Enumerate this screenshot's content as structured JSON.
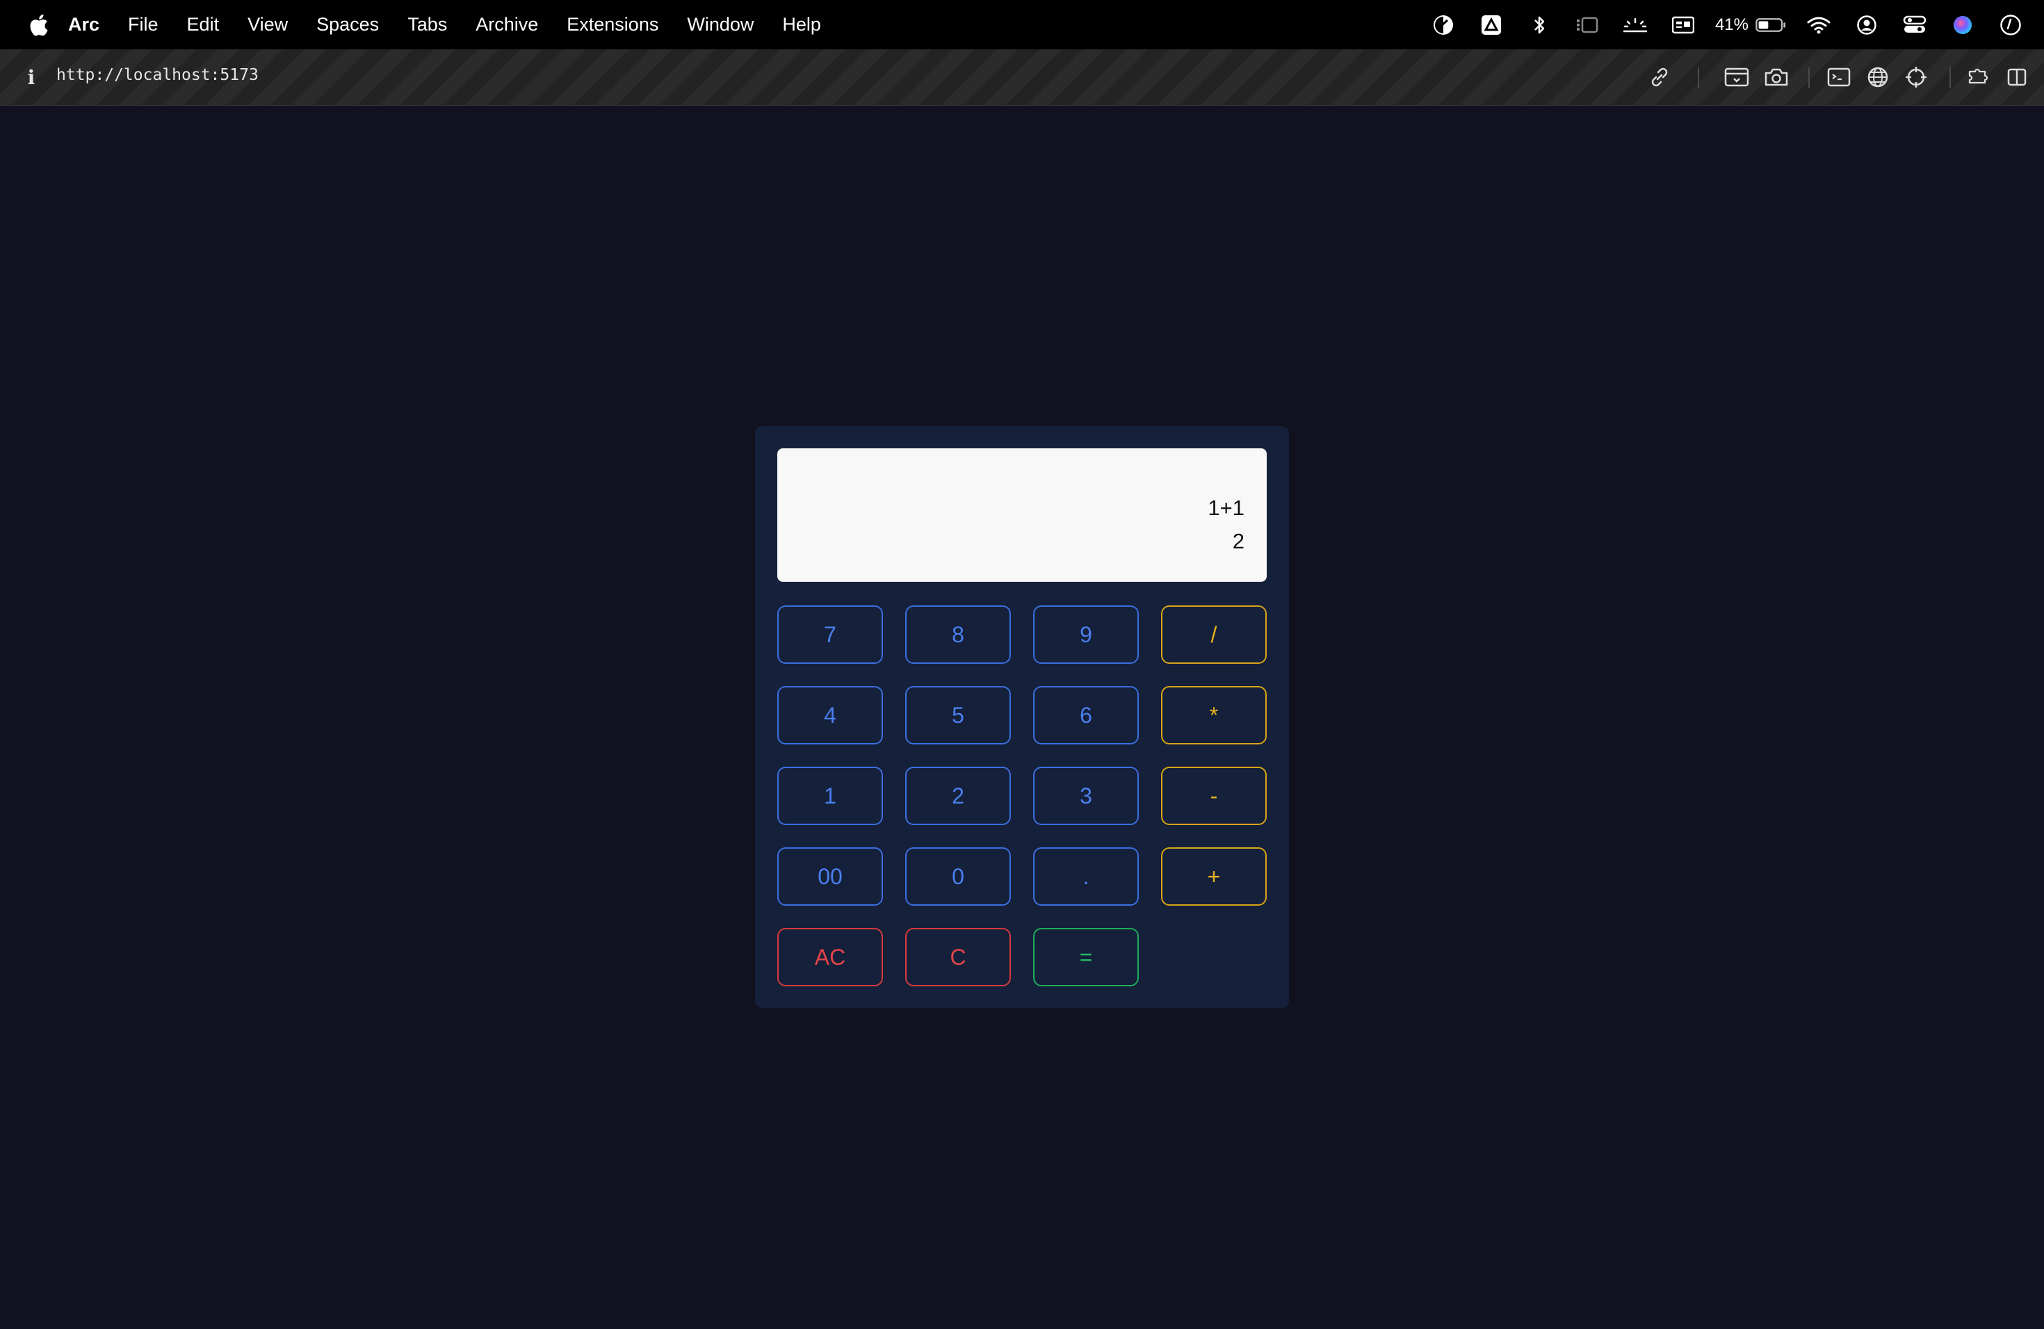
{
  "menubar": {
    "app_name": "Arc",
    "items": [
      "File",
      "Edit",
      "View",
      "Spaces",
      "Tabs",
      "Archive",
      "Extensions",
      "Window",
      "Help"
    ],
    "battery_percent": "41%"
  },
  "toolbar": {
    "url": "http://localhost:5173",
    "info_glyph": "i"
  },
  "calculator": {
    "expression": "1+1",
    "result": "2",
    "keys": {
      "seven": "7",
      "eight": "8",
      "nine": "9",
      "divide": "/",
      "four": "4",
      "five": "5",
      "six": "6",
      "multiply": "*",
      "one": "1",
      "two": "2",
      "three": "3",
      "minus": "-",
      "double_zero": "00",
      "zero": "0",
      "decimal": ".",
      "plus": "+",
      "all_clear": "AC",
      "clear": "C",
      "equals": "="
    }
  },
  "colors": {
    "page_background": "#11111f",
    "calculator_panel": "#15203a",
    "number_key": "#3b6fe0",
    "operator_key": "#d9a514",
    "clear_key": "#d63a3f",
    "equals_key": "#1fae5a"
  }
}
